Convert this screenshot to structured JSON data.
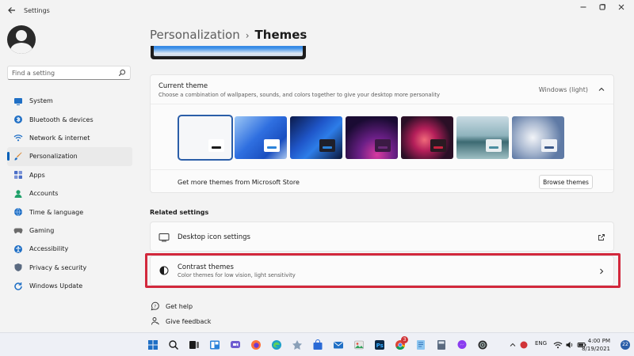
{
  "window": {
    "title": "Settings",
    "back_icon": "arrow-left-icon",
    "controls": [
      "minimize-icon",
      "maximize-icon",
      "close-icon"
    ]
  },
  "search": {
    "placeholder": "Find a setting",
    "icon": "search-icon"
  },
  "sidebar": {
    "items": [
      {
        "label": "System",
        "icon": "monitor-icon",
        "color": "#1f6fc5",
        "active": false
      },
      {
        "label": "Bluetooth & devices",
        "icon": "bluetooth-icon",
        "color": "#1f6fc5",
        "active": false
      },
      {
        "label": "Network & internet",
        "icon": "wifi-icon",
        "color": "#1f6fc5",
        "active": false
      },
      {
        "label": "Personalization",
        "icon": "brush-icon",
        "color": "#d9822b",
        "active": true
      },
      {
        "label": "Apps",
        "icon": "apps-icon",
        "color": "#4a6ec7",
        "active": false
      },
      {
        "label": "Accounts",
        "icon": "person-icon",
        "color": "#1fa06a",
        "active": false
      },
      {
        "label": "Time & language",
        "icon": "globe-clock-icon",
        "color": "#1f6fc5",
        "active": false
      },
      {
        "label": "Gaming",
        "icon": "gamepad-icon",
        "color": "#6b6b6b",
        "active": false
      },
      {
        "label": "Accessibility",
        "icon": "accessibility-icon",
        "color": "#1f6fc5",
        "active": false
      },
      {
        "label": "Privacy & security",
        "icon": "shield-icon",
        "color": "#5a6a80",
        "active": false
      },
      {
        "label": "Windows Update",
        "icon": "update-icon",
        "color": "#1f6fc5",
        "active": false
      }
    ]
  },
  "breadcrumb": {
    "parent": "Personalization",
    "separator": "›",
    "current": "Themes"
  },
  "current_theme": {
    "title": "Current theme",
    "description": "Choose a combination of wallpapers, sounds, and colors together to give your desktop more personality",
    "value": "Windows (light)",
    "chevron_icon": "chevron-up-icon",
    "themes": [
      {
        "bg": "#f6f7f9",
        "bar": "#ffffff",
        "accent": "#1b1b1b",
        "selected": true
      },
      {
        "bg": "linear-gradient(135deg,#9cc7f5 0%,#2f6fe0 45%,#1a4fc0 75%,#a9c7ef 100%)",
        "bar": "#ffffff",
        "accent": "#2b82d9",
        "selected": false
      },
      {
        "bg": "linear-gradient(135deg,#0b1a4a 0%,#1f56c9 40%,#2d7de8 60%,#0a1538 100%)",
        "bar": "#1f1f2a",
        "accent": "#2b82d9",
        "selected": false
      },
      {
        "bg": "radial-gradient(circle at 60% 90%,#d83aa0 0%,#6a1f86 35%,#1a0b33 75%)",
        "bar": "#3b1a44",
        "accent": "#6a2a78",
        "selected": false
      },
      {
        "bg": "radial-gradient(circle at 45% 55%,#f06a7a 0%,#b51f5a 30%,#2a0f26 70%)",
        "bar": "#2a1a22",
        "accent": "#c8233f",
        "selected": false
      },
      {
        "bg": "linear-gradient(180deg,#c9dbe3 0%,#8fb3bd 45%,#3c6a72 60%,#9fc0c4 100%)",
        "bar": "#e8eef0",
        "accent": "#4a8ea0",
        "selected": false
      },
      {
        "bg": "radial-gradient(circle at 40% 50%,#f2f4f8 0%,#a9b8d0 40%,#5f7aa5 75%)",
        "bar": "#eef1f6",
        "accent": "#3d5a8a",
        "selected": false
      }
    ],
    "store_text": "Get more themes from Microsoft Store",
    "browse_label": "Browse themes"
  },
  "related": {
    "title": "Related settings",
    "desktop_icons": {
      "title": "Desktop icon settings",
      "icon": "monitor-outline-icon",
      "right_icon": "external-link-icon"
    },
    "contrast": {
      "title": "Contrast themes",
      "subtitle": "Color themes for low vision, light sensitivity",
      "icon": "contrast-icon",
      "right_icon": "chevron-right-icon"
    }
  },
  "help": {
    "get_help": "Get help",
    "give_feedback": "Give feedback"
  },
  "taskbar": {
    "badge_count": "3",
    "language": "ENG",
    "time": "4:00 PM",
    "date": "8/19/2021",
    "notifications": "22"
  }
}
